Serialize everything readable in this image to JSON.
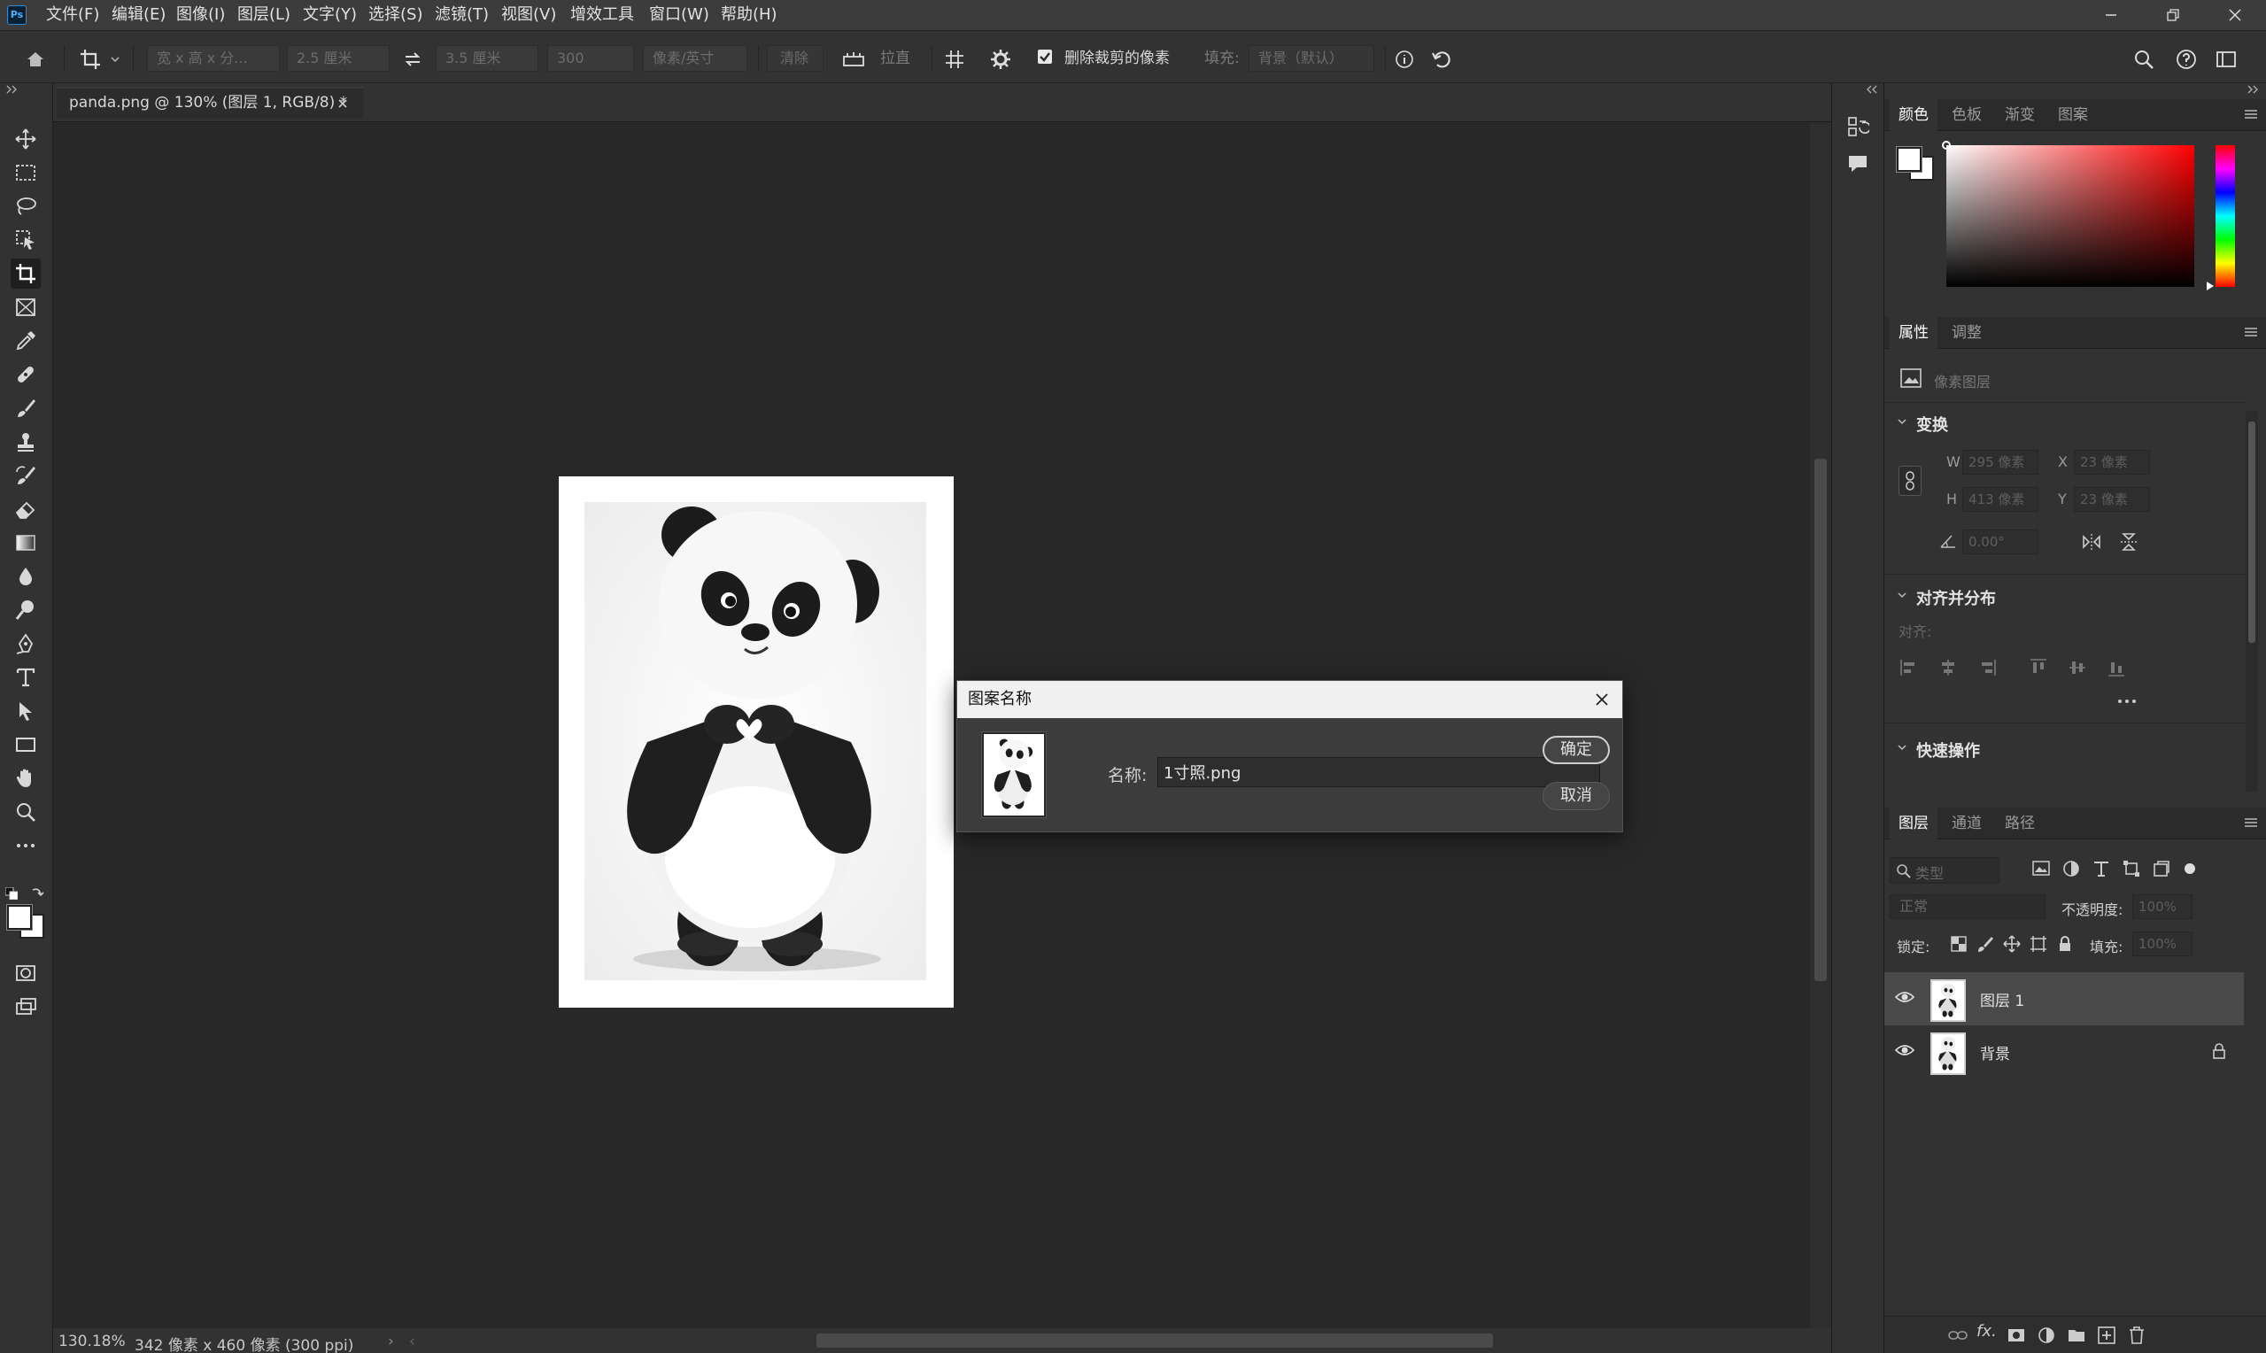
{
  "app": {
    "name": "Ps",
    "menus": [
      "文件(F)",
      "编辑(E)",
      "图像(I)",
      "图层(L)",
      "文字(Y)",
      "选择(S)",
      "滤镜(T)",
      "视图(V)",
      "增效工具",
      "窗口(W)",
      "帮助(H)"
    ]
  },
  "options_bar": {
    "ratio_preset": "宽 x 高 x 分...",
    "width": "2.5 厘米",
    "height": "3.5 厘米",
    "resolution": "300",
    "resolution_unit": "像素/英寸",
    "clear_label": "清除",
    "straighten_label": "拉直",
    "delete_cropped_label": "删除裁剪的像素",
    "delete_cropped_checked": true,
    "fill_label": "填充:",
    "fill_value": "背景（默认）"
  },
  "document": {
    "tab_title": "panda.png @ 130% (图层 1, RGB/8) *",
    "zoom": "130.18%",
    "status_info": "342 像素 x 460 像素 (300 ppi)"
  },
  "dialog": {
    "title": "图案名称",
    "name_label": "名称:",
    "name_value": "1寸照.png",
    "ok_label": "确定",
    "cancel_label": "取消"
  },
  "color_panel": {
    "tabs": [
      "颜色",
      "色板",
      "渐变",
      "图案"
    ],
    "active_tab": 0,
    "foreground": "#ffffff",
    "background": "#ffffff",
    "hue_color": "#ff0000"
  },
  "properties_panel": {
    "tabs": [
      "属性",
      "调整"
    ],
    "active_tab": 0,
    "layer_type": "像素图层",
    "transform_title": "变换",
    "w_label": "W",
    "w_value": "295 像素",
    "h_label": "H",
    "h_value": "413 像素",
    "x_label": "X",
    "x_value": "23 像素",
    "y_label": "Y",
    "y_value": "23 像素",
    "angle_value": "0.00°",
    "align_title": "对齐并分布",
    "align_label": "对齐:",
    "quick_actions_title": "快速操作"
  },
  "layers_panel": {
    "tabs": [
      "图层",
      "通道",
      "路径"
    ],
    "active_tab": 0,
    "filter_placeholder": "类型",
    "blend_mode": "正常",
    "opacity_label": "不透明度:",
    "opacity_value": "100%",
    "lock_label": "锁定:",
    "fill_label": "填充:",
    "fill_value": "100%",
    "layers": [
      {
        "name": "图层 1",
        "visible": true,
        "selected": true,
        "locked": false
      },
      {
        "name": "背景",
        "visible": true,
        "selected": false,
        "locked": true
      }
    ]
  }
}
